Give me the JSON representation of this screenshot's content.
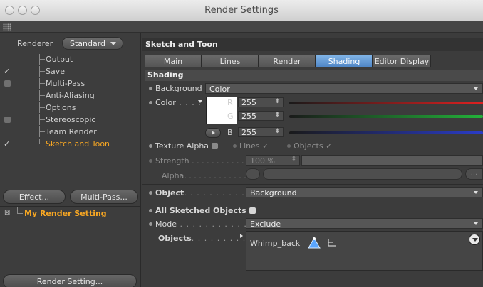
{
  "window": {
    "title": "Render Settings"
  },
  "left": {
    "renderer_label": "Renderer",
    "renderer_value": "Standard",
    "items": [
      {
        "label": "Output",
        "marker": "none",
        "active": false
      },
      {
        "label": "Save",
        "marker": "check",
        "active": false
      },
      {
        "label": "Multi-Pass",
        "marker": "box",
        "active": false
      },
      {
        "label": "Anti-Aliasing",
        "marker": "none",
        "active": false
      },
      {
        "label": "Options",
        "marker": "none",
        "active": false
      },
      {
        "label": "Stereoscopic",
        "marker": "box",
        "active": false
      },
      {
        "label": "Team Render",
        "marker": "none",
        "active": false
      },
      {
        "label": "Sketch and Toon",
        "marker": "check",
        "active": true
      }
    ],
    "effect_button": "Effect...",
    "multipass_button": "Multi-Pass...",
    "setting_name": "My Render Setting",
    "render_setting_button": "Render Setting..."
  },
  "right": {
    "section_title": "Sketch and Toon",
    "tabs": [
      {
        "label": "Main",
        "active": false
      },
      {
        "label": "Lines",
        "active": false
      },
      {
        "label": "Render",
        "active": false
      },
      {
        "label": "Shading",
        "active": true
      },
      {
        "label": "Editor Display",
        "active": false
      }
    ],
    "subsection": "Shading",
    "background_label": "Background",
    "background_value": "Color",
    "color_label": "Color",
    "color_dots": " . . . .",
    "color_value": "#ffffff",
    "channels": [
      {
        "letter": "R",
        "value": "255",
        "slider_color": "#e02020"
      },
      {
        "letter": "G",
        "value": "255",
        "slider_color": "#23b23a"
      },
      {
        "letter": "B",
        "value": "255",
        "slider_color": "#2a3cc8"
      }
    ],
    "texture_alpha_label": "Texture Alpha",
    "lines_label": "Lines",
    "lines_check": "✓",
    "objects_check_label": "Objects",
    "objects_check": "✓",
    "strength_label": "Strength",
    "strength_dots": " . . . . . . . . . . .",
    "strength_value": "100 %",
    "alpha_label": "Alpha",
    "alpha_dots": ". . . . . . . . . . . . . . .",
    "alpha_button": "...",
    "object_label": "Object",
    "object_dots": ". . . . . . . . . . . . .",
    "object_value": "Background",
    "all_sketched_label": "All Sketched Objects",
    "mode_label": "Mode",
    "mode_dots": " . . . . . . . . . . . . . .",
    "mode_value": "Exclude",
    "objects_label": "Objects",
    "objects_dots": ". . . . . . . . .",
    "objects_list": [
      "Whimp_back"
    ]
  }
}
